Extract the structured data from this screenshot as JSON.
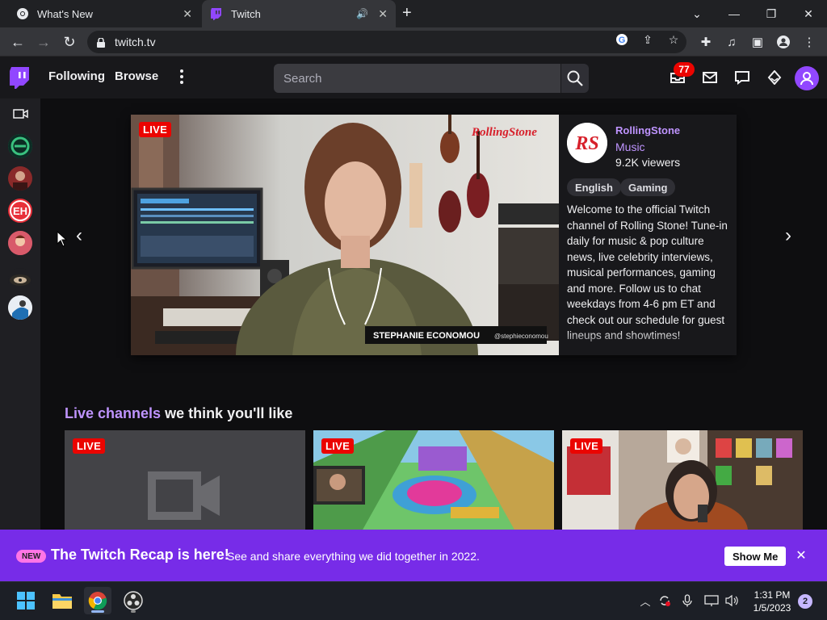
{
  "browser": {
    "tabs": [
      {
        "title": "What's New",
        "icon": "chrome-icon"
      },
      {
        "title": "Twitch",
        "icon": "twitch-icon",
        "active": true,
        "audio": "speaker-icon"
      }
    ],
    "url": "twitch.tv"
  },
  "twitch": {
    "nav": {
      "following": "Following",
      "browse": "Browse",
      "search_placeholder": "Search",
      "notification_count": "77"
    },
    "featured": {
      "live_label": "LIVE",
      "channel": "RollingStone",
      "category": "Music",
      "viewers": "9.2K viewers",
      "tags": [
        "English",
        "Gaming"
      ],
      "description": "Welcome to the official Twitch channel of Rolling Stone! Tune-in daily for music & pop culture news, live celebrity interviews, musical performances, gaming and more. Follow us to chat weekdays from 4-6 pm ET and check out our schedule for guest lineups and showtimes!",
      "video_overlay_name": "STEPHANIE ECONOMOU",
      "video_overlay_handle": "@stephieconomou",
      "video_watermark": "RollingStone",
      "avatar_text": "RS"
    },
    "section": {
      "title_highlight": "Live channels",
      "title_rest": " we think you'll like"
    },
    "cards": [
      {
        "live_label": "LIVE"
      },
      {
        "live_label": "LIVE"
      },
      {
        "live_label": "LIVE"
      }
    ],
    "sidebar_avatars": [
      "EH"
    ]
  },
  "promo": {
    "badge": "NEW",
    "title": "The Twitch Recap is here!",
    "subtitle": "See and share everything we did together in 2022.",
    "button": "Show Me"
  },
  "taskbar": {
    "time": "1:31 PM",
    "date": "1/5/2023",
    "notifications": "2"
  },
  "colors": {
    "twitch_purple": "#9147ff",
    "promo_purple": "#772ce8",
    "live_red": "#eb0400",
    "link_purple": "#bf94ff"
  }
}
